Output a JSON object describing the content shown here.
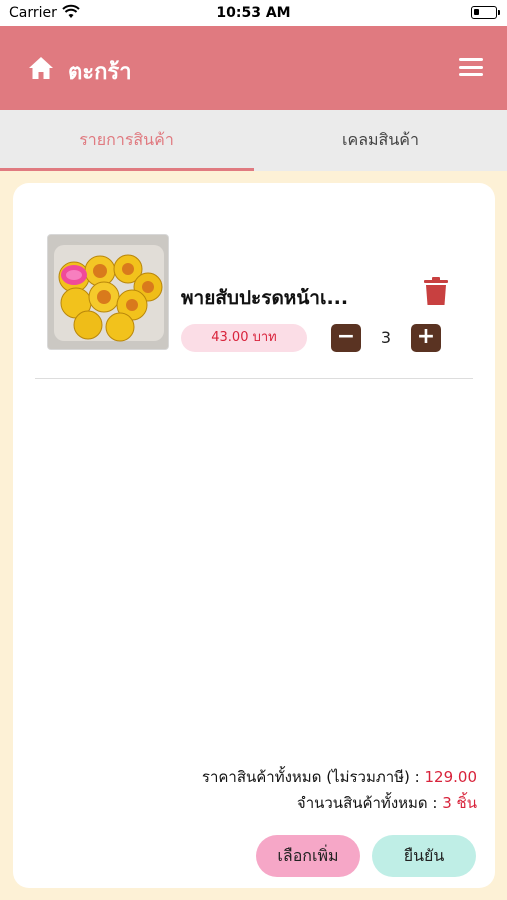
{
  "status_bar": {
    "carrier": "Carrier",
    "time": "10:53 AM"
  },
  "header": {
    "title": "ตะกร้า"
  },
  "tabs": [
    {
      "label": "รายการสินค้า",
      "active": true
    },
    {
      "label": "เคลมสินค้า",
      "active": false
    }
  ],
  "cart_items": [
    {
      "name": "พายสับปะรดหน้าเ...",
      "price": "43.00 บาท",
      "quantity": "3"
    }
  ],
  "stepper": {
    "minus": "−",
    "plus": "+"
  },
  "summary": {
    "total_label": "ราคาสินค้าทั้งหมด (ไม่รวมภาษี) : ",
    "total_value": "129.00",
    "count_label": "จำนวนสินค้าทั้งหมด : ",
    "count_value": "3 ชิ้น"
  },
  "buttons": {
    "more": "เลือกเพิ่ม",
    "confirm": "ยืนยัน"
  },
  "colors": {
    "header": "#e07a80",
    "accent_red": "#d8233b",
    "background": "#fdf1d6",
    "stepper": "#5a3322"
  },
  "icons": [
    "wifi-icon",
    "battery-icon",
    "home-icon",
    "menu-icon",
    "trash-icon"
  ]
}
